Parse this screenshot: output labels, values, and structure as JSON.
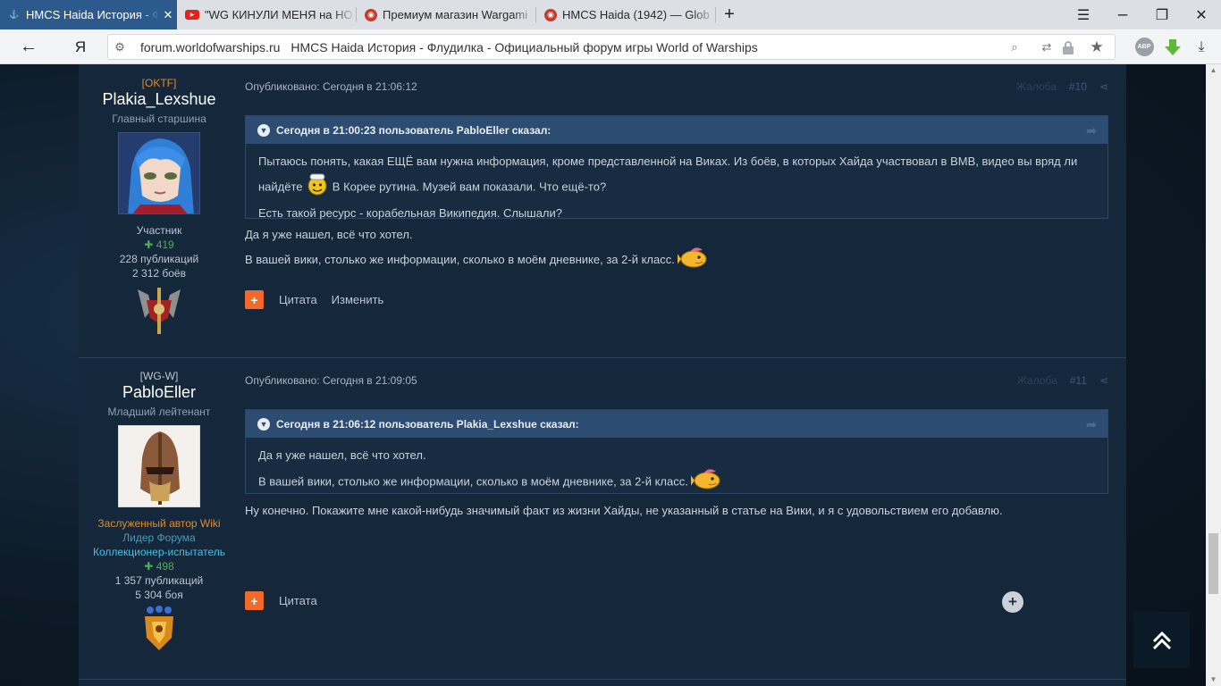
{
  "browser": {
    "tabs": [
      {
        "title": "HMCS Haida История - Ф",
        "close": "✕",
        "active": true
      },
      {
        "title": "\"WG КИНУЛИ МЕНЯ на НО",
        "active": false
      },
      {
        "title": "Премиум магазин Wargami",
        "active": false
      },
      {
        "title": "HMCS Haida (1942) — Glob",
        "active": false
      }
    ],
    "new_tab": "+",
    "menu": "☰",
    "restore": "❐",
    "close": "✕",
    "back": "←",
    "yandex": "Я",
    "url_domain": "forum.worldofwarships.ru",
    "url_title": "HMCS Haida История - Флудилка - Официальный форум игры World of Warships",
    "abp": "ABP"
  },
  "posts": [
    {
      "clan": "[OKTF]",
      "clan_color": "#e08a2c",
      "nickname": "Plakia_Lexshue",
      "rank": "Главный старшина",
      "group": "Участник",
      "reputation": "419",
      "publications": "228 публикаций",
      "battles": "2 312 боёв",
      "published": "Опубликовано: Сегодня в 21:06:12",
      "report": "Жалоба",
      "number": "#10",
      "quote_header": "Сегодня в 21:00:23 пользователь PabloEller сказал:",
      "quote_lines": [
        "Пытаюсь понять, какая ЕЩЁ вам нужна информация, кроме представленной на Виках. Из боёв, в которых Хайда участвовал в ВМВ, видео вы вряд ли",
        "найдёте",
        "В Корее рутина. Музей вам показали. Что ещё-то?",
        "Есть такой ресурс - корабельная Википедия. Слышали?"
      ],
      "text_lines": [
        "Да я уже нашел, всё что хотел.",
        "В вашей вики, столько же информации, сколько в моём дневнике, за 2-й класс."
      ],
      "actions": [
        "Цитата",
        "Изменить"
      ]
    },
    {
      "clan": "[WG-W]",
      "clan_color": "#b9c6d2",
      "nickname": "PabloEller",
      "rank": "Младший лейтенант",
      "badge_wiki": "Заслуженный автор Wiki",
      "badge_leader": "Лидер Форума",
      "badge_tester": "Коллекционер-испытатель",
      "reputation": "498",
      "publications": "1 357 публикаций",
      "battles": "5 304 боя",
      "published": "Опубликовано: Сегодня в 21:09:05",
      "report": "Жалоба",
      "number": "#11",
      "quote_header": "Сегодня в 21:06:12 пользователь Plakia_Lexshue сказал:",
      "quote_lines": [
        "Да я уже нашел, всё что хотел.",
        "В вашей вики, столько же информации, сколько в моём дневнике, за 2-й класс."
      ],
      "text_lines": [
        "Ну конечно. Покажите мне какой-нибудь значимый факт из жизни Хайды, не указанный в статье на Вики, и я с удовольствием его добавлю."
      ],
      "actions": [
        "Цитата"
      ]
    }
  ],
  "colors": {
    "accent_orange": "#f06a2c",
    "reputation_green": "#4caf50",
    "quote_header": "#2d4c72",
    "wiki_badge": "#e08a2c",
    "leader_badge": "#4a9bb8",
    "tester_badge": "#3fc4e8"
  },
  "icons": {
    "multiquote": "+",
    "to_top": "chevron-double-up-icon",
    "share": "share-icon"
  }
}
